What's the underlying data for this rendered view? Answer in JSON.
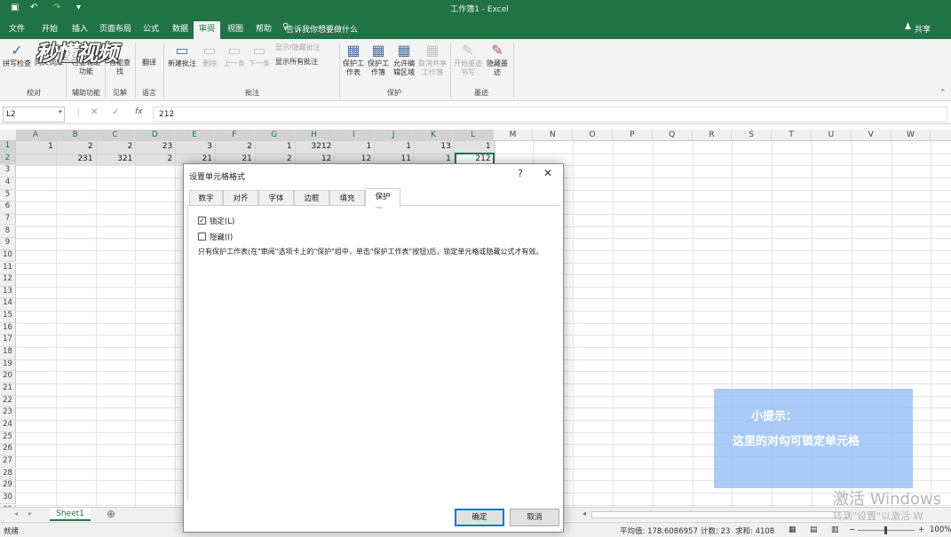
{
  "window": {
    "title": "工作簿1 - Excel"
  },
  "tabs": [
    "文件",
    "开始",
    "插入",
    "页面布局",
    "公式",
    "数据",
    "审阅",
    "视图",
    "帮助"
  ],
  "active_tab": "审阅",
  "tellme": "告诉我你想要做什么",
  "share": "共享",
  "watermark": "秒懂视频",
  "ribbon": {
    "groups": [
      "校对",
      "辅助功能",
      "见解",
      "语言",
      "批注",
      "保护",
      "墨迹"
    ],
    "buttons": {
      "spell": "拼写检查",
      "thesaurus": "同义词库",
      "check_access": "检查辅助功能",
      "access_sub": "辅助功能",
      "smart_lookup": "智能查找",
      "translate": "翻译",
      "new_comment": "新建批注",
      "delete": "删除",
      "prev": "上一条",
      "next": "下一条",
      "show_hide": "显示/隐藏批注",
      "show_all": "显示所有批注",
      "protect_sheet": "保护工作表",
      "protect_book": "保护工作簿",
      "allow_edit": "允许编辑区域",
      "unshare": "取消共享工作簿",
      "start_ink": "开始墨迹书写",
      "hide_ink": "隐藏墨迹"
    }
  },
  "formula_bar": {
    "name_box": "L2",
    "value": "212",
    "fx": "fx"
  },
  "columns": [
    "A",
    "B",
    "C",
    "D",
    "E",
    "F",
    "G",
    "H",
    "I",
    "J",
    "K",
    "L",
    "M",
    "N",
    "O",
    "P",
    "Q",
    "R",
    "S",
    "T",
    "U",
    "V",
    "W"
  ],
  "rows": [
    "1",
    "2",
    "3",
    "4",
    "5",
    "6",
    "7",
    "8",
    "9",
    "10",
    "11",
    "12",
    "13",
    "14",
    "15",
    "16",
    "17",
    "18",
    "19",
    "20",
    "21",
    "22",
    "23",
    "24",
    "25",
    "26",
    "27",
    "28",
    "29",
    "30",
    "31"
  ],
  "cells": {
    "row1": [
      "1",
      "2",
      "2",
      "23",
      "3",
      "2",
      "1",
      "3212",
      "1",
      "1",
      "13",
      "1"
    ],
    "row2": [
      "",
      "231",
      "321",
      "2",
      "21",
      "21",
      "2",
      "12",
      "12",
      "11",
      "1",
      "212"
    ]
  },
  "sheet_tab": "Sheet1",
  "status": {
    "ready": "就绪",
    "average": "平均值: 178.6086957",
    "count": "计数: 23",
    "sum": "求和: 4108",
    "zoom": "100%"
  },
  "dialog": {
    "title": "设置单元格格式",
    "help": "?",
    "close": "✕",
    "tabs": [
      "数字",
      "对齐",
      "字体",
      "边框",
      "填充",
      "保护"
    ],
    "active_tab": "保护",
    "lock_label": "锁定(L)",
    "lock_checked": true,
    "hide_label": "隐藏(I)",
    "hide_checked": false,
    "note": "只有保护工作表(在\"审阅\"选项卡上的\"保护\"组中，单击\"保护工作表\"按钮)后，锁定单元格或隐藏公式才有效。",
    "ok": "确定",
    "cancel": "取消"
  },
  "tip": {
    "title": "小提示：",
    "body": "这里的对勾可锁定单元格"
  },
  "activation": {
    "line1": "激活 Windows",
    "line2": "转到\"设置\"以激活 W"
  },
  "colors": {
    "brand": "#217346",
    "tip": "#96bef5"
  }
}
